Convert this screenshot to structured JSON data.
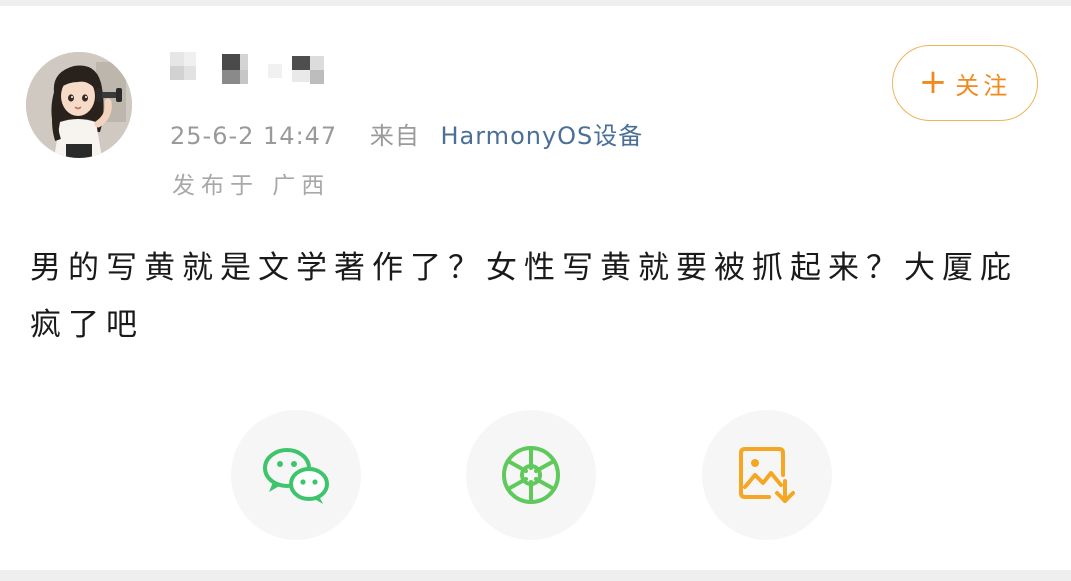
{
  "post": {
    "author": {
      "avatar_icon": "avatar-girl-illustration",
      "name_obscured": true
    },
    "time": "25-6-2 14:47",
    "source_prefix": "来自",
    "device": "HarmonyOS设备",
    "location": "发布于 广西",
    "follow": {
      "plus_symbol": "+",
      "label": "关注"
    },
    "text": "男的写黄就是文学著作了？女性写黄就要被抓起来？大厦庇疯了吧"
  },
  "share": {
    "items": [
      {
        "icon": "wechat-icon",
        "color": "#3ec46d"
      },
      {
        "icon": "moments-icon",
        "color": "#5fc95b"
      },
      {
        "icon": "save-image-icon",
        "color": "#f5a623"
      }
    ]
  },
  "colors": {
    "accent": "#f08a1c",
    "device_link": "#4b6f97",
    "meta_gray": "#9a9a9a"
  }
}
